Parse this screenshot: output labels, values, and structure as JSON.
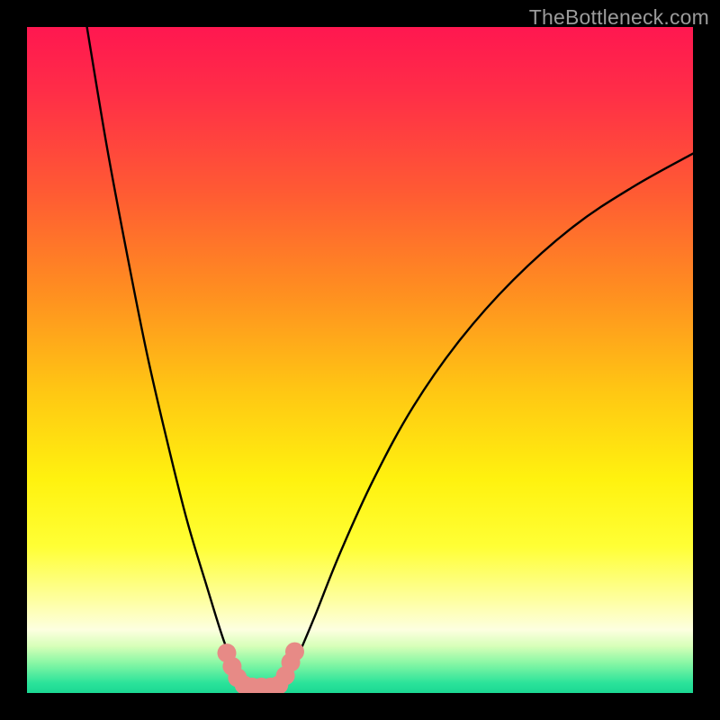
{
  "watermark": {
    "text": "TheBottleneck.com"
  },
  "colors": {
    "black": "#000000",
    "curve": "#000000",
    "marker": "#e78a86",
    "gradient_stops": [
      {
        "offset": 0.0,
        "color": "#ff1750"
      },
      {
        "offset": 0.1,
        "color": "#ff2e47"
      },
      {
        "offset": 0.25,
        "color": "#ff5b33"
      },
      {
        "offset": 0.4,
        "color": "#ff8f20"
      },
      {
        "offset": 0.55,
        "color": "#ffc813"
      },
      {
        "offset": 0.68,
        "color": "#fff20f"
      },
      {
        "offset": 0.78,
        "color": "#ffff35"
      },
      {
        "offset": 0.86,
        "color": "#feffa0"
      },
      {
        "offset": 0.905,
        "color": "#fdffe0"
      },
      {
        "offset": 0.93,
        "color": "#d6ffb8"
      },
      {
        "offset": 0.955,
        "color": "#88f7a5"
      },
      {
        "offset": 0.985,
        "color": "#2be39a"
      },
      {
        "offset": 1.0,
        "color": "#1bd893"
      }
    ]
  },
  "chart_data": {
    "type": "line",
    "title": "",
    "xlabel": "",
    "ylabel": "",
    "x_range": [
      0,
      100
    ],
    "y_range": [
      0,
      100
    ],
    "series": [
      {
        "name": "left-curve",
        "x": [
          9,
          12,
          15,
          18,
          21,
          24,
          27,
          29.5,
          31.5,
          33
        ],
        "y": [
          100,
          82,
          66,
          51,
          38,
          26,
          16,
          8,
          3,
          0
        ]
      },
      {
        "name": "right-curve",
        "x": [
          38,
          40,
          43,
          47,
          52,
          58,
          65,
          73,
          82,
          91,
          100
        ],
        "y": [
          0,
          4,
          11,
          21,
          32,
          43,
          53,
          62,
          70,
          76,
          81
        ]
      }
    ],
    "markers": {
      "name": "highlight-region",
      "points": [
        {
          "x": 30.0,
          "y": 6.0
        },
        {
          "x": 30.8,
          "y": 4.0
        },
        {
          "x": 31.6,
          "y": 2.3
        },
        {
          "x": 32.6,
          "y": 1.2
        },
        {
          "x": 33.8,
          "y": 0.9
        },
        {
          "x": 35.2,
          "y": 0.9
        },
        {
          "x": 36.6,
          "y": 0.9
        },
        {
          "x": 37.8,
          "y": 1.2
        },
        {
          "x": 38.8,
          "y": 2.6
        },
        {
          "x": 39.6,
          "y": 4.6
        },
        {
          "x": 40.2,
          "y": 6.2
        }
      ]
    }
  }
}
